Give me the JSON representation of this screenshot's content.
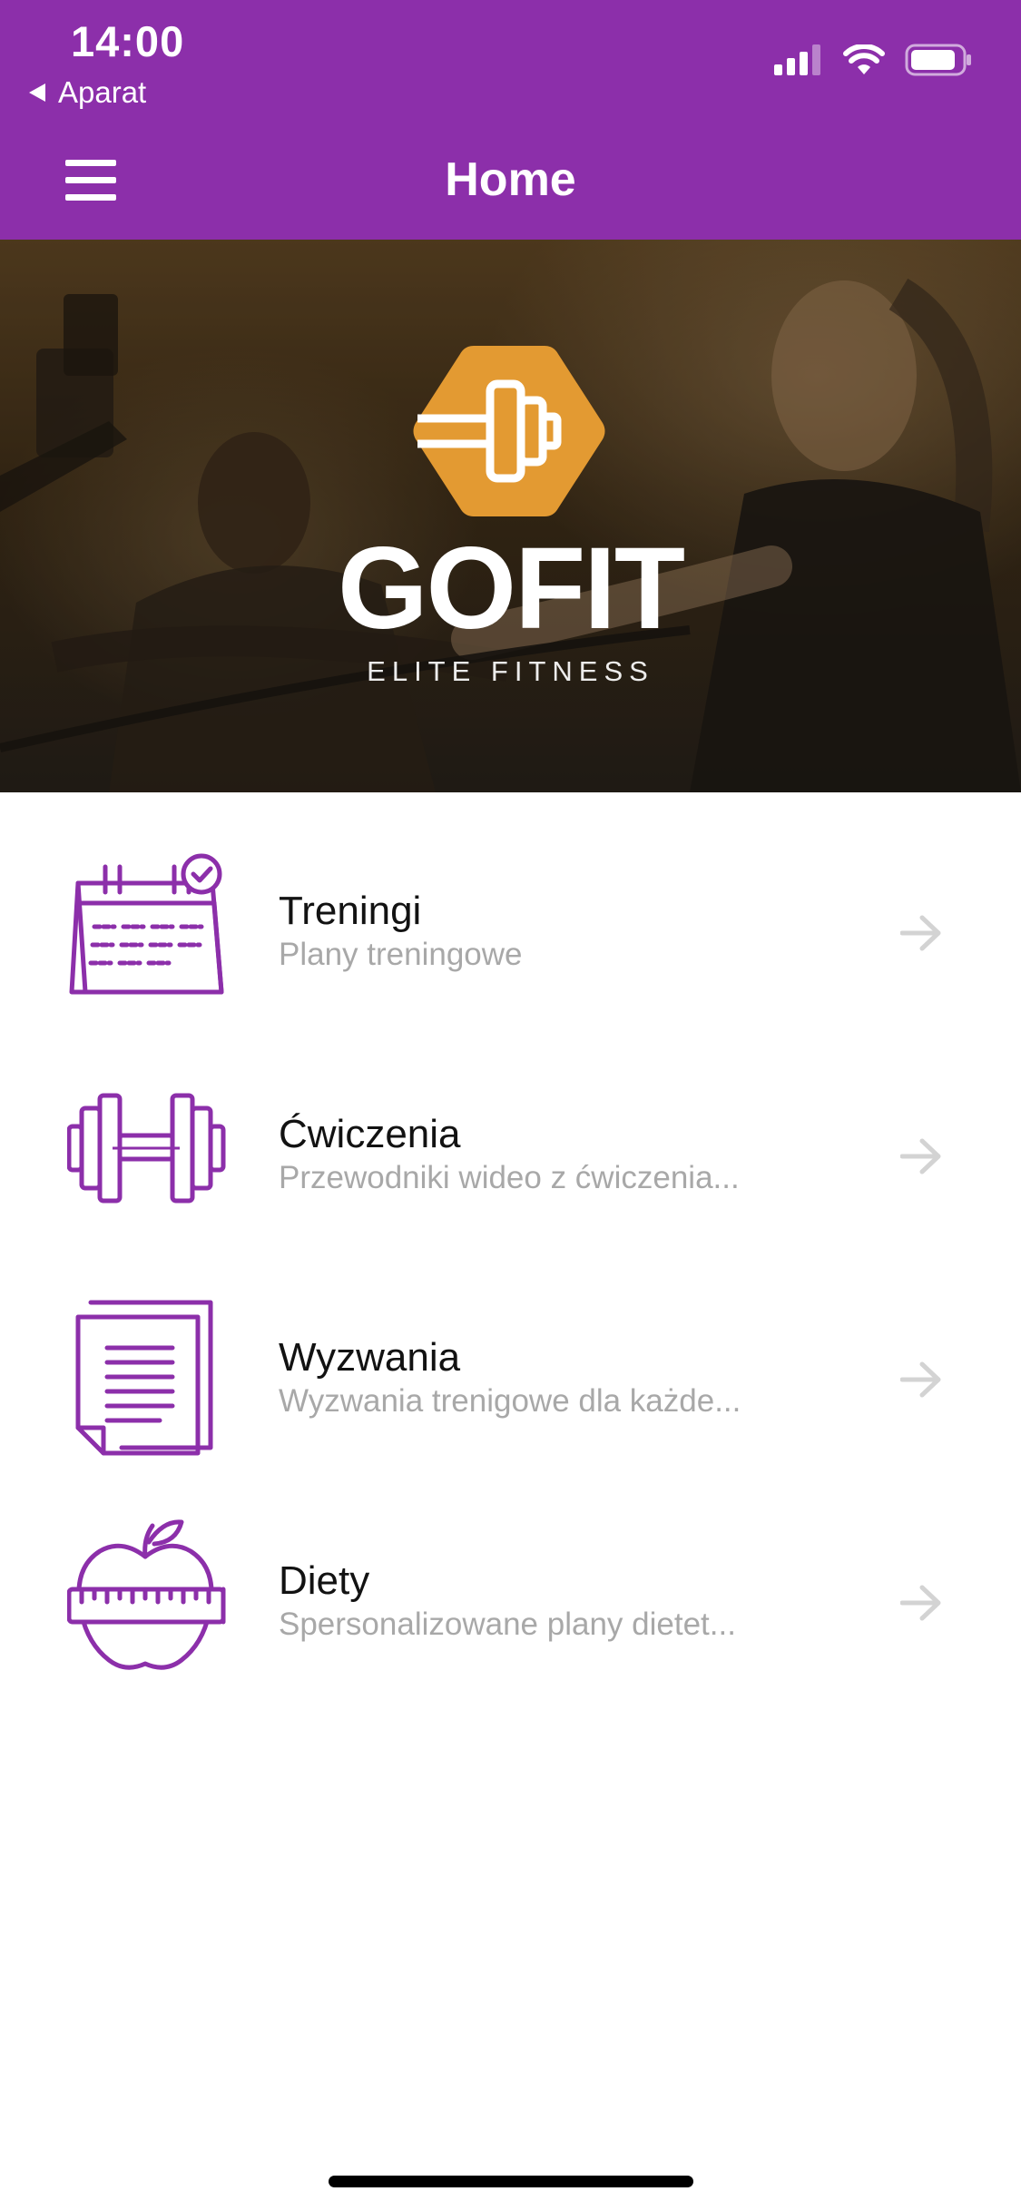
{
  "status_bar": {
    "time": "14:00",
    "back_app": "Aparat"
  },
  "nav": {
    "title": "Home",
    "menu_icon": "hamburger-icon"
  },
  "hero": {
    "brand": "GOFIT",
    "tagline": "ELITE FITNESS",
    "logo_icon": "dumbbell-hexagon-icon"
  },
  "menu": {
    "items": [
      {
        "title": "Treningi",
        "subtitle": "Plany treningowe",
        "icon": "calendar-check-icon"
      },
      {
        "title": "Ćwiczenia",
        "subtitle": "Przewodniki wideo z ćwiczenia...",
        "icon": "dumbbell-icon"
      },
      {
        "title": "Wyzwania",
        "subtitle": "Wyzwania trenigowe dla każde...",
        "icon": "documents-icon"
      },
      {
        "title": "Diety",
        "subtitle": "Spersonalizowane plany dietet...",
        "icon": "apple-measuring-tape-icon"
      }
    ]
  },
  "colors": {
    "primary": "#8c2faa",
    "accent": "#e39a32",
    "title_text": "#121212",
    "subtitle_text": "#a8a8a8",
    "arrow": "#d3d3d3"
  }
}
